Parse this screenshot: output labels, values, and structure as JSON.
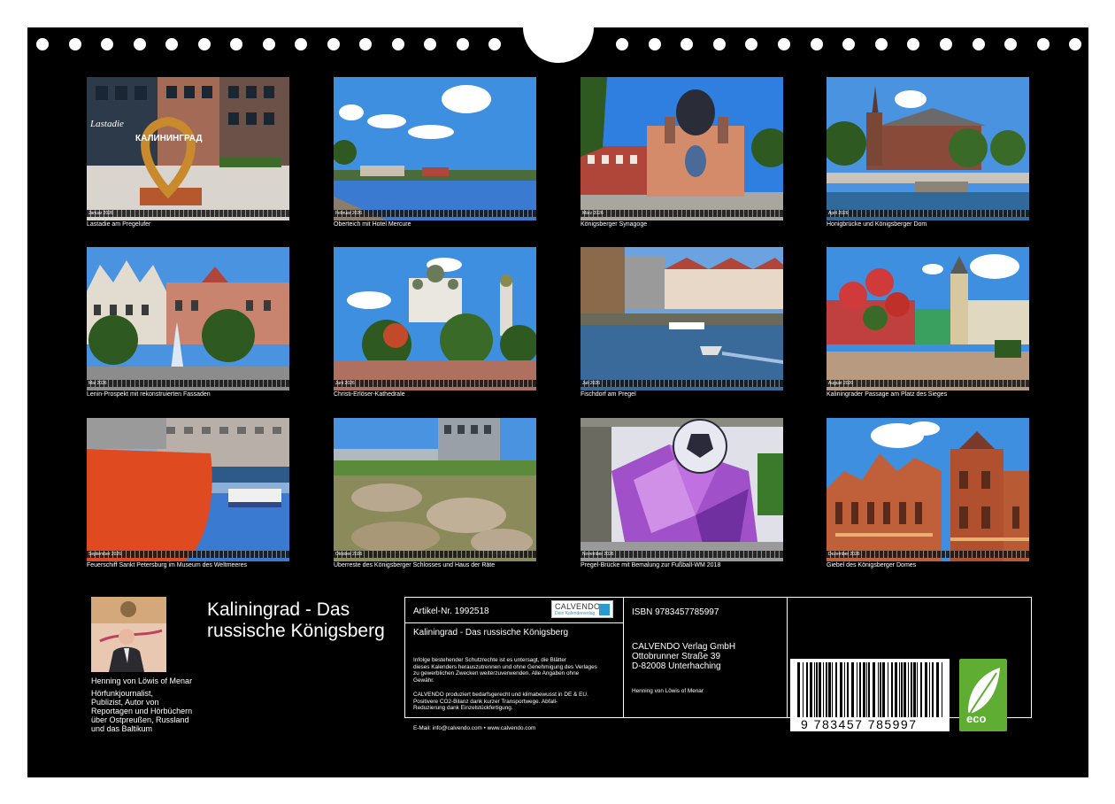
{
  "months": [
    {
      "caption": "Lastadie am Pregelufer",
      "strip": "Januar 2026"
    },
    {
      "caption": "Oberteich mit Hotel Mercure",
      "strip": "Februar 2026"
    },
    {
      "caption": "Königsberger Synagoge",
      "strip": "März 2026"
    },
    {
      "caption": "Honigbrücke und Königsberger Dom",
      "strip": "April 2026"
    },
    {
      "caption": "Lenin-Prospekt mit rekonstruierten Fassaden",
      "strip": "Mai 2026"
    },
    {
      "caption": "Christi-Erlöser-Kathedrale",
      "strip": "Juni 2026"
    },
    {
      "caption": "Fischdorf am Pregel",
      "strip": "Juli 2026"
    },
    {
      "caption": "Kaliningrader Passage am Platz des Sieges",
      "strip": "August 2026"
    },
    {
      "caption": "Feuerschiff Sankt Petersburg im Museum des Weltmeeres",
      "strip": "September 2026"
    },
    {
      "caption": "Überreste des Königsberger Schlosses und Haus der Räte",
      "strip": "Oktober 2026"
    },
    {
      "caption": "Pregel-Brücke mit Bemalung zur Fußball-WM 2018",
      "strip": "November 2026"
    },
    {
      "caption": "Giebel des Königsberger Domes",
      "strip": "Dezember 2026"
    }
  ],
  "photo1_sign": "КАЛИНИНГРАД",
  "photo1_store": "Lastadie",
  "author": {
    "name": "Henning von Löwis of Menar",
    "bio": "Hörfunkjournalist,\nPublizist, Autor von\nReportagen und Hörbüchern\nüber Ostpreußen, Russland\nund das Baltikum"
  },
  "title": "Kaliningrad - Das russische Königsberg",
  "info": {
    "article": "Artikel-Nr. 1992518",
    "product_title": "Kaliningrad - Das russische Königsberg",
    "legal": "Infolge bestehender Schutzrechte ist es untersagt, die Blätter\ndieses Kalenders herauszutrennen und ohne Genehmigung des Verlages\nzu gewerblichen Zwecken weiterzuverwenden. Alle Angaben ohne\nGewähr.",
    "climate": "CALVENDO produziert bedarfsgerecht und klimabewusst in DE & EU.\nPositivere CO2-Bilanz dank kurzer Transportwege. Abfall-\nReduzierung dank Einzelstückfertigung.",
    "contact": "E-Mail: info@calvendo.com • www.calvendo.com",
    "logo_name": "CALVENDO",
    "logo_sub": "Dein Kalenderverlag",
    "isbn": "ISBN 9783457785997",
    "publisher": "CALVENDO Verlag GmbH\nOttobrunner Straße 39\nD-82008 Unterhaching",
    "author_small": "Henning von Löwis of Menar",
    "barcode_number": "9 783457 785997",
    "eco_label": "eco"
  },
  "colors": {
    "background": "#000000",
    "text": "#ffffff",
    "eco": "#5fad32",
    "calvendo_blue": "#2a9bd0"
  }
}
